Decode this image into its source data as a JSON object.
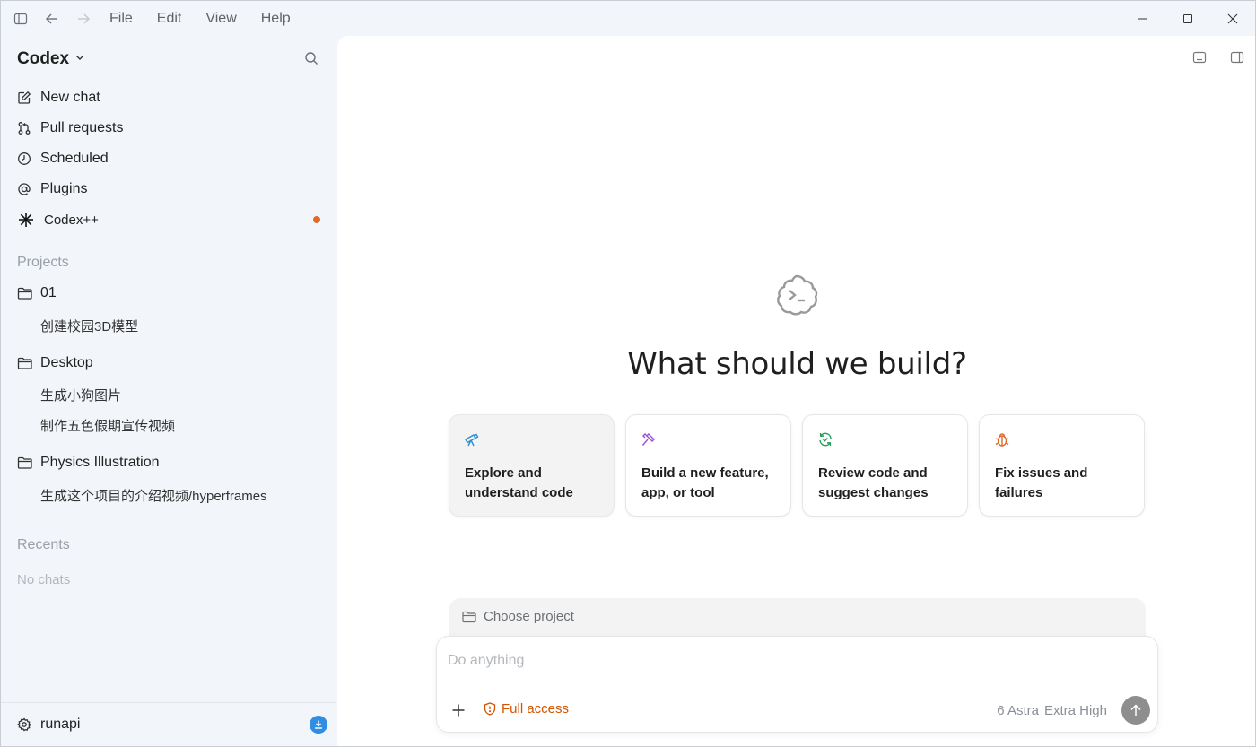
{
  "titlebar": {
    "menu": [
      "File",
      "Edit",
      "View",
      "Help"
    ]
  },
  "sidebar": {
    "brand": "Codex",
    "nav": [
      {
        "label": "New chat",
        "icon": "edit-icon"
      },
      {
        "label": "Pull requests",
        "icon": "git-pull-request-icon"
      },
      {
        "label": "Scheduled",
        "icon": "clock-icon"
      },
      {
        "label": "Plugins",
        "icon": "at-sign-icon"
      },
      {
        "label": "Codex++",
        "icon": "asterisk-icon",
        "badge": "unread-dot"
      }
    ],
    "projects_label": "Projects",
    "projects": [
      {
        "name": "01",
        "chats": [
          "创建校园3D模型"
        ]
      },
      {
        "name": "Desktop",
        "chats": [
          "生成小狗图片",
          "制作五色假期宣传视频"
        ]
      },
      {
        "name": "Physics Illustration",
        "chats": [
          "生成这个项目的介绍视频/hyperframes"
        ]
      }
    ],
    "recents_label": "Recents",
    "recents_empty": "No chats",
    "user": "runapi"
  },
  "main": {
    "headline": "What should we build?",
    "cards": [
      {
        "label": "Explore and understand code",
        "icon": "telescope-icon",
        "color": "#2d8fd5"
      },
      {
        "label": "Build a new feature, app, or tool",
        "icon": "hammer-icon",
        "color": "#9b4fd6"
      },
      {
        "label": "Review code and suggest changes",
        "icon": "refresh-check-icon",
        "color": "#1f9d55"
      },
      {
        "label": "Fix issues and failures",
        "icon": "bug-icon",
        "color": "#e0692a"
      }
    ],
    "project_picker": "Choose project",
    "composer": {
      "placeholder": "Do anything",
      "access": "Full access",
      "model": "6 Astra",
      "effort": "Extra High"
    }
  },
  "colors": {
    "accent_orange": "#d35400",
    "sidebar_bg": "#f2f5fa",
    "badge_blue": "#2f8de4"
  }
}
